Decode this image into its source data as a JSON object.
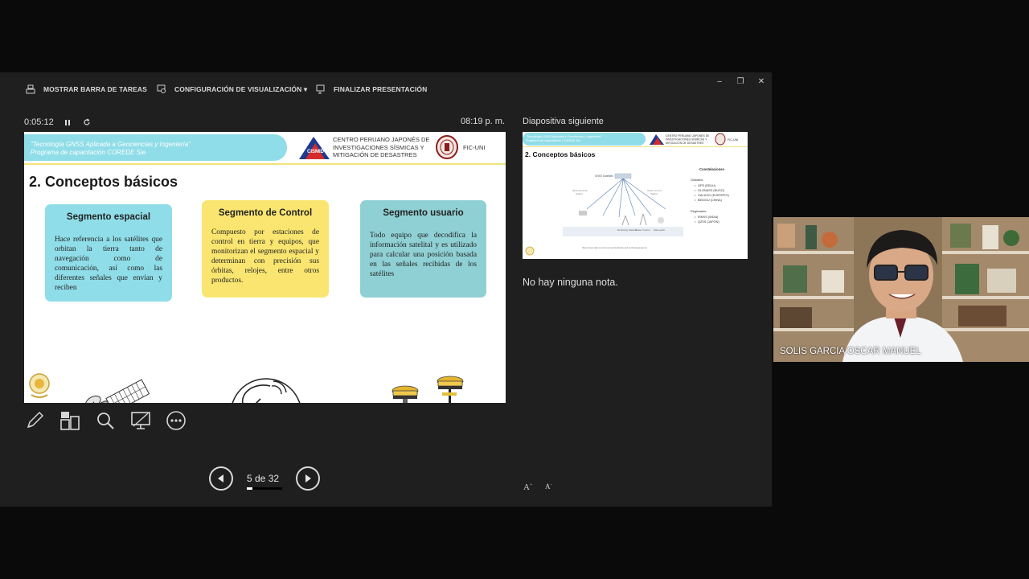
{
  "toolbar": {
    "show_taskbar": "MOSTRAR BARRA DE TAREAS",
    "display_settings": "CONFIGURACIÓN DE VISUALIZACIÓN ▾",
    "end_show": "FINALIZAR PRESENTACIÓN"
  },
  "window": {
    "minimize": "–",
    "restore": "❐",
    "close": "✕"
  },
  "timer": {
    "elapsed": "0:05:12",
    "clock": "08:19 p. m."
  },
  "slide": {
    "header_line1": "\"Tecnología GNSS Aplicada a Geociencias y Ingeniería\"",
    "header_line2": "Programa de capacitación COREDE Sie",
    "institution_line1": "CENTRO PERUANO JAPONÉS DE",
    "institution_line2": "INVESTIGACIONES SÍSMICAS Y",
    "institution_line3": "MITIGACIÓN DE DESASTRES",
    "logo_cp_text": "CISMID",
    "fic_label": "FIC-UNI",
    "title": "2.  Conceptos básicos",
    "cards": [
      {
        "heading": "Segmento espacial",
        "body": "Hace referencia a los satélites que orbitan la tierra tanto de navegación como de comunicación, así como las diferentes señales que envían y reciben"
      },
      {
        "heading": "Segmento de Control",
        "body": "Compuesto por estaciones de control en tierra y equipos, que monitorizan el segmento espacial y determinan con precisión sus órbitas, relojes, entre otros productos."
      },
      {
        "heading": "Segmento usuario",
        "body": "Todo equipo que decodifica la información satelital y es utilizado para calcular una posición basada en las señales recibidas de los satélites"
      }
    ]
  },
  "navigation": {
    "counter": "5 de 32",
    "current": 5,
    "total": 32
  },
  "next": {
    "label": "Diapositiva siguiente",
    "header_line1": "\"Tecnología GNSS Aplicada a Geociencias y Ingeniería\"",
    "header_line2": "Programa de capacitación COREDE Sie",
    "institution_line1": "CENTRO PERUANO JAPONÉS DE",
    "institution_line2": "INVESTIGACIONES SÍSMICAS Y",
    "institution_line3": "MITIGACIÓN DE DESASTRES",
    "fic_label": "FIC-UNI",
    "title": "2.   Conceptos básicos",
    "diagram_hub": "GNSS Satellites",
    "diagram_label_left1": "Multi-Nominal",
    "diagram_label_left2": "Station",
    "diagram_label_right1": "Other Control",
    "diagram_label_right2": "Station",
    "diagram_bottom1": "Monitoring Stations",
    "diagram_bottom2": "Master Control",
    "diagram_bottom3": "Data uplink",
    "url": "https://www.digi.com/resources/standards-and-technologies/gnss",
    "constellations_title": "Constelaciones",
    "globals_label": "Globales:",
    "globals": [
      "GPS (EEUU)",
      "GLONASS (RUSO)",
      "GALILEO (EUROPEO)",
      "BEIDOU (CHINA)"
    ],
    "regionals_label": "Regionales:",
    "regionals": [
      "IRNSS (INDIA)",
      "QZSS (JAPÓN)"
    ]
  },
  "notes": {
    "text": "No hay ninguna nota."
  },
  "font_controls": {
    "increase": "A",
    "decrease": "A"
  },
  "video": {
    "participant_name": "SOLIS GARCIA OSCAR MANUEL"
  },
  "colors": {
    "presenter_bg": "#1f1f1f",
    "cyan_card": "#8fdde8",
    "yellow_card": "#f9e56f",
    "teal_card": "#8fd0d4"
  }
}
